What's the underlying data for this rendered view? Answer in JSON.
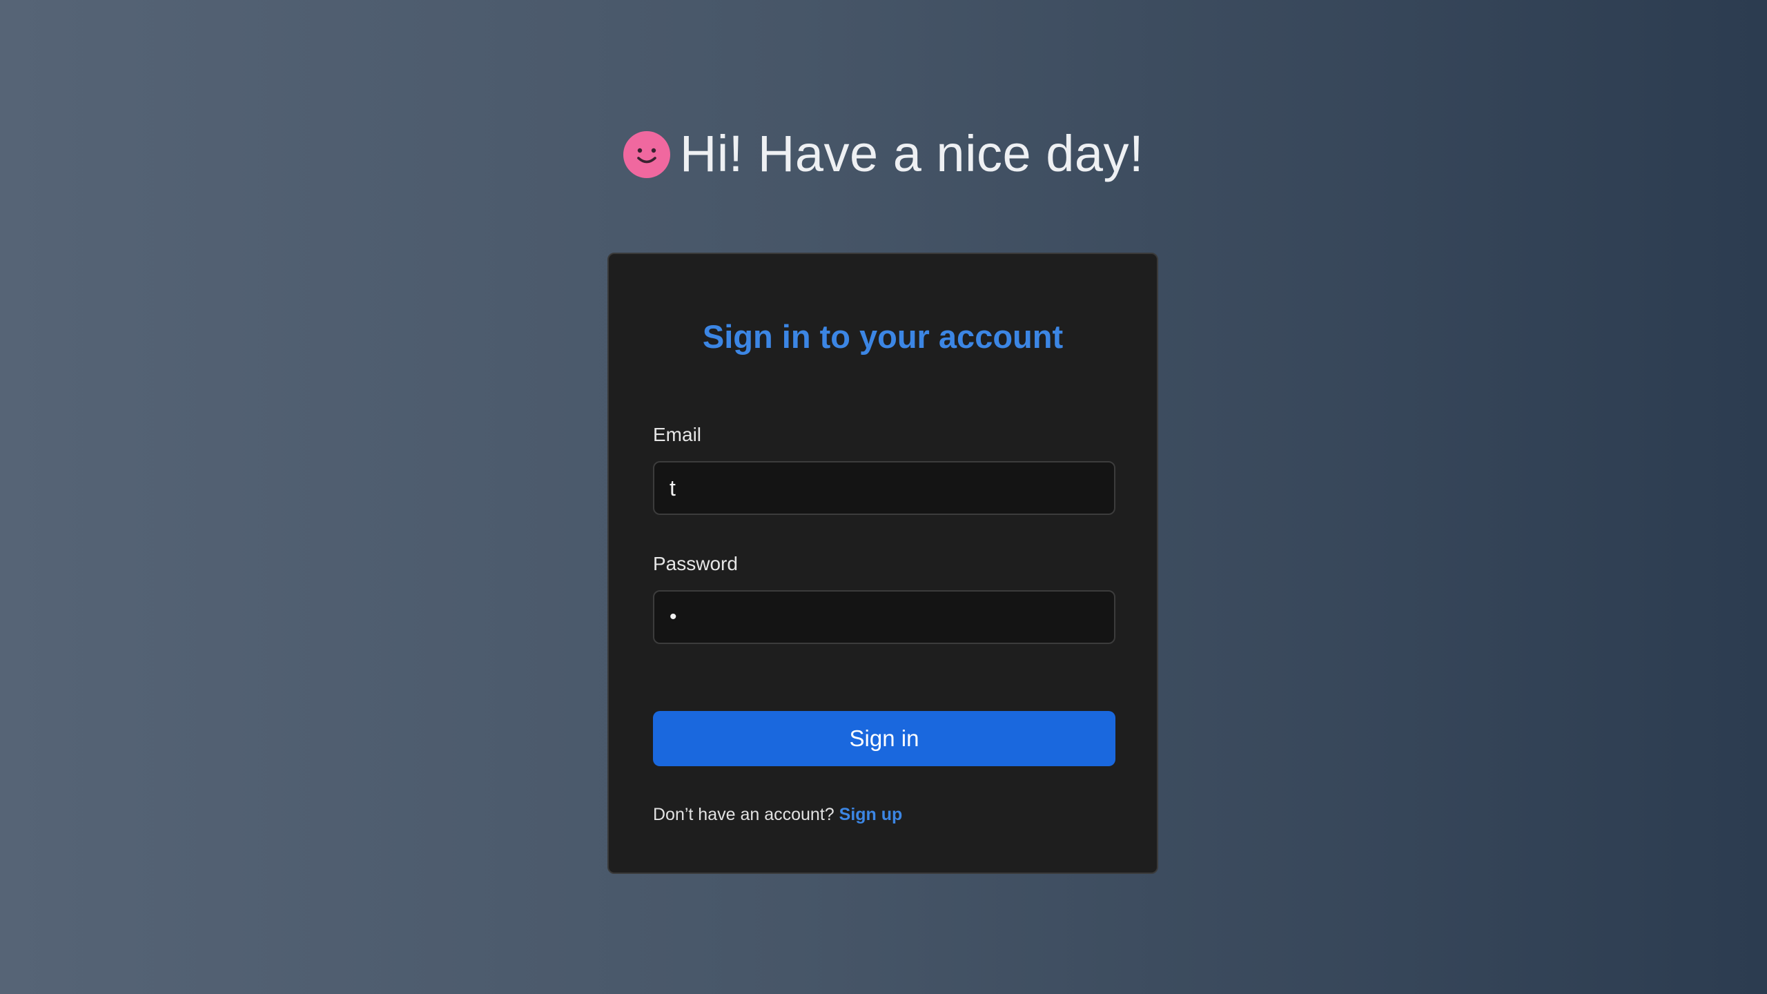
{
  "page": {
    "headline": "Hi! Have a nice day!",
    "headline_icon": "smiley-face-icon",
    "background_gradient": [
      "#566476",
      "#2c3c50"
    ]
  },
  "login_card": {
    "title": "Sign in to your account",
    "email": {
      "label": "Email",
      "value": "t"
    },
    "password": {
      "label": "Password",
      "value": "•"
    },
    "submit_label": "Sign in",
    "signup_prompt": "Don’t have an account?",
    "signup_link": "Sign up"
  },
  "colors": {
    "accent": "#3c86e4",
    "button": "#1a68de",
    "card_bg": "#1e1e1e",
    "input_bg": "#141414",
    "smiley": "#f0689f"
  }
}
